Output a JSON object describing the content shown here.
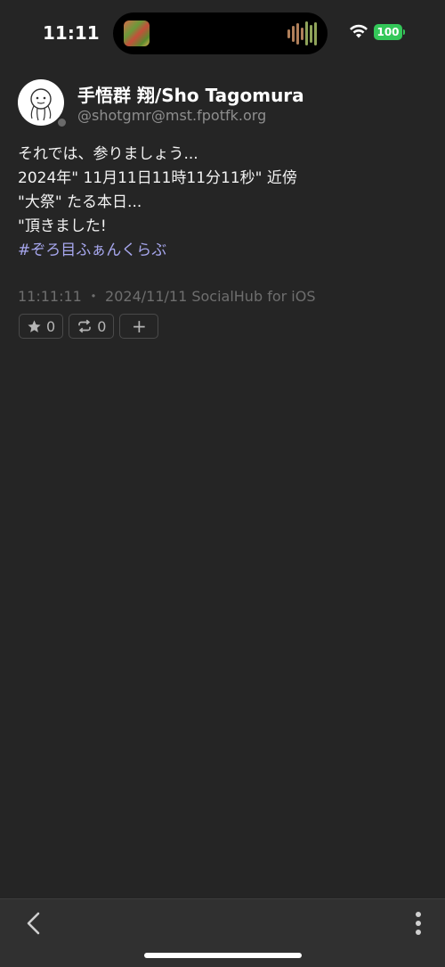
{
  "status": {
    "time": "11:11",
    "battery": "100"
  },
  "post": {
    "display_name": "手悟群 翔/Sho Tagomura",
    "handle": "@shotgmr@mst.fpotfk.org",
    "lines": [
      "それでは、参りましょう...",
      "2024年\" 11月11日11時11分11秒\" 近傍",
      "\"大祭\" たる本日...",
      "\"頂きました!"
    ],
    "hashtag": "#ぞろ目ふぁんくらぶ",
    "meta": "11:11:11 ・ 2024/11/11  SocialHub for iOS",
    "favourites_count": "0",
    "boosts_count": "0",
    "more_label": "+"
  },
  "icons": {
    "back": "chevron-left-icon",
    "more": "vertical-ellipsis-icon",
    "favourite": "star-icon",
    "boost": "repeat-icon",
    "wifi": "wifi-icon"
  },
  "colors": {
    "background": "#252525",
    "hashtag": "#a7a7ee",
    "battery": "#34c759",
    "muted": "#6e6e6e"
  }
}
